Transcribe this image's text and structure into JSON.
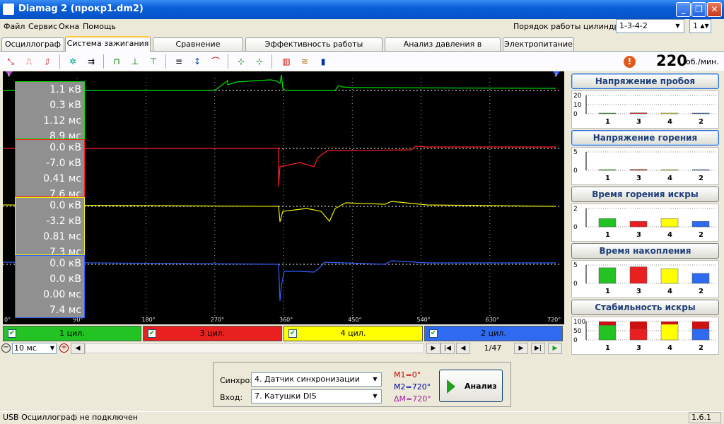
{
  "window": {
    "title": "Diamag 2 (прокр1.dm2)"
  },
  "menu": [
    "Файл",
    "Сервис",
    "Окна",
    "Помощь"
  ],
  "cylinder_order": {
    "label": "Порядок работы цилиндров",
    "value": "1-3-4-2",
    "spin_value": "1"
  },
  "tabs": [
    "Осциллограф",
    "Система зажигания",
    "Сравнение цилиндров",
    "Эффективность работы цилиндров",
    "Анализ давления в цилиндре",
    "Электропитание"
  ],
  "active_tab": "Система зажигания",
  "rpm": {
    "value": "220",
    "unit": "об./мин."
  },
  "scope": {
    "x_ticks": [
      "0°",
      "90°",
      "180°",
      "270°",
      "360°",
      "450°",
      "540°",
      "630°",
      "720°"
    ],
    "marker_left": "1",
    "marker_right": "2",
    "channels": [
      {
        "color": "#00e000",
        "lines": [
          "1.1 кВ",
          "0.3 кВ",
          "1.12 мс",
          "8.9 мс"
        ]
      },
      {
        "color": "#ff2020",
        "lines": [
          "0.0 кВ",
          "-7.0 кВ",
          "0.41 мс",
          "7.6 мс"
        ]
      },
      {
        "color": "#f0f000",
        "lines": [
          "0.0 кВ",
          "-3.2 кВ",
          "0.81 мс",
          "7.3 мс"
        ]
      },
      {
        "color": "#3060ff",
        "lines": [
          "0.0 кВ",
          "0.0 кВ",
          "0.00 мс",
          "7.4 мс"
        ]
      }
    ]
  },
  "channel_buttons": [
    {
      "label": "1 цил.",
      "color": "#22c322"
    },
    {
      "label": "3 цил.",
      "color": "#e82020"
    },
    {
      "label": "4 цил.",
      "color": "#ffff00"
    },
    {
      "label": "2 цил.",
      "color": "#2f6bf0"
    }
  ],
  "timebase": {
    "value": "10 мс",
    "page": "1/47"
  },
  "analysis": {
    "sync_label": "Синхро:",
    "sync_value": "4.  Датчик синхронизации",
    "input_label": "Вход:",
    "input_value": "7.  Катушки DIS",
    "m1": "M1=0°",
    "m2": "M2=720°",
    "dm": "ΔM=720°",
    "button": "Анализ"
  },
  "right_panel": {
    "cylinders": [
      "1",
      "3",
      "4",
      "2"
    ],
    "blocks": [
      {
        "title": "Напряжение пробоя",
        "ticks": [
          "20",
          "10",
          "0"
        ],
        "values": [
          0.02,
          0.05,
          0.01,
          0.01
        ]
      },
      {
        "title": "Напряжение горения",
        "ticks": [
          "5",
          "0"
        ],
        "values": [
          0.0,
          0.05,
          0.0,
          0.0
        ]
      },
      {
        "title": "Время горения искры",
        "ticks": [
          "2",
          "0"
        ],
        "values": [
          0.45,
          0.3,
          0.45,
          0.3
        ]
      },
      {
        "title": "Время накопления",
        "ticks": [
          "5",
          "0"
        ],
        "values": [
          0.85,
          0.9,
          0.8,
          0.55
        ]
      },
      {
        "title": "Стабильность искры",
        "ticks": [
          "100",
          "50",
          "0"
        ],
        "values": [
          0.8,
          0.6,
          0.85,
          0.6
        ]
      }
    ]
  },
  "status": {
    "text": "USB Осциллограф не подключен",
    "version": "1.6.1"
  }
}
